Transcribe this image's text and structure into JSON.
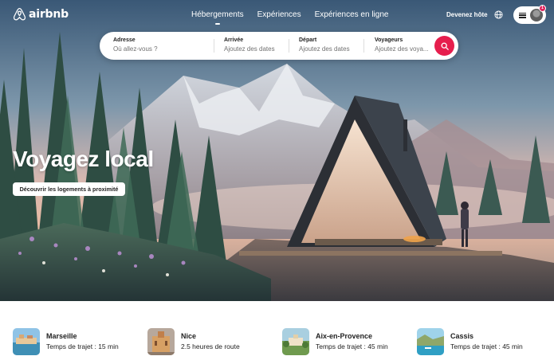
{
  "brand": {
    "name": "airbnb",
    "color": "#ffffff",
    "accent": "#e61e4d"
  },
  "nav": {
    "tabs": [
      {
        "label": "Hébergements",
        "active": true
      },
      {
        "label": "Expériences",
        "active": false
      },
      {
        "label": "Expériences en ligne",
        "active": false
      }
    ]
  },
  "header": {
    "host_label": "Devenez hôte",
    "globe_icon": "globe-icon",
    "menu_icon": "hamburger-icon",
    "notification_count": "1"
  },
  "search": {
    "fields": [
      {
        "label": "Adresse",
        "placeholder": "Où allez-vous ?"
      },
      {
        "label": "Arrivée",
        "placeholder": "Ajoutez des dates"
      },
      {
        "label": "Départ",
        "placeholder": "Ajoutez des dates"
      },
      {
        "label": "Voyageurs",
        "placeholder": "Ajoutez des voya..."
      }
    ],
    "button_icon": "search-icon"
  },
  "hero": {
    "title": "Voyagez local",
    "button_label": "Découvrir les logements à proximité"
  },
  "destinations": [
    {
      "name": "Marseille",
      "time": "Temps de trajet : 15 min"
    },
    {
      "name": "Nice",
      "time": "2.5 heures de route"
    },
    {
      "name": "Aix-en-Provence",
      "time": "Temps de trajet : 45 min"
    },
    {
      "name": "Cassis",
      "time": "Temps de trajet : 45 min"
    }
  ]
}
